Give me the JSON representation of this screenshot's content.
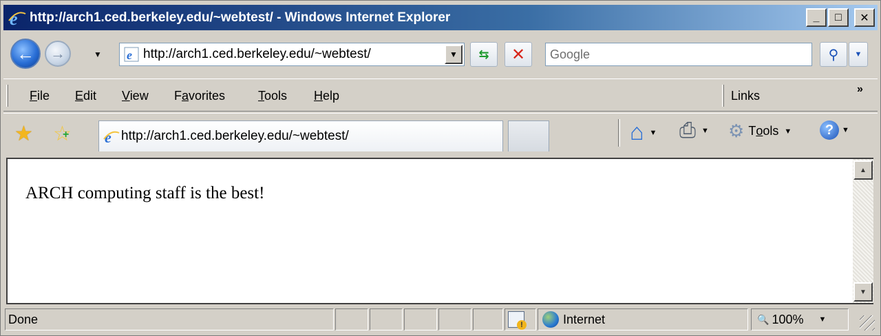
{
  "window": {
    "title": "http://arch1.ced.berkeley.edu/~webtest/ - Windows Internet Explorer",
    "controls": {
      "minimize": "_",
      "maximize": "□",
      "close": "✕"
    }
  },
  "navbar": {
    "back_icon": "back-arrow-icon",
    "forward_icon": "forward-arrow-icon",
    "address_value": "http://arch1.ced.berkeley.edu/~webtest/",
    "search_placeholder": "Google",
    "refresh_glyph": "⇆",
    "stop_glyph": "✕",
    "search_glyph": "⚲",
    "dropdown_glyph": "▼"
  },
  "menubar": {
    "items": [
      {
        "label": "File",
        "accel": "F",
        "rest": "ile"
      },
      {
        "label": "Edit",
        "accel": "E",
        "rest": "dit"
      },
      {
        "label": "View",
        "accel": "V",
        "rest": "iew"
      },
      {
        "label": "Favorites",
        "pre": "F",
        "accel": "a",
        "rest": "vorites"
      },
      {
        "label": "Tools",
        "accel": "T",
        "rest": "ools"
      },
      {
        "label": "Help",
        "accel": "H",
        "rest": "elp"
      }
    ],
    "links_label": "Links",
    "chevron": "»"
  },
  "tabs": {
    "active_tab_title": "http://arch1.ced.berkeley.edu/~webtest/"
  },
  "commandbar": {
    "tools_label": "Tools",
    "tools_pre": "T",
    "tools_accel": "o",
    "tools_rest": "ols",
    "home_glyph": "⌂",
    "print_glyph": "⎙",
    "gear_glyph": "⚙",
    "help_glyph": "?",
    "dd_glyph": "▼"
  },
  "content": {
    "page_text": "ARCH computing staff is the best!"
  },
  "statusbar": {
    "status_text": "Done",
    "zone_text": "Internet",
    "zoom_text": "100%",
    "zoom_glyph": "🔍"
  },
  "colors": {
    "titlebar_start": "#0a246a",
    "titlebar_end": "#a6caf0",
    "chrome": "#d4d0c8"
  }
}
